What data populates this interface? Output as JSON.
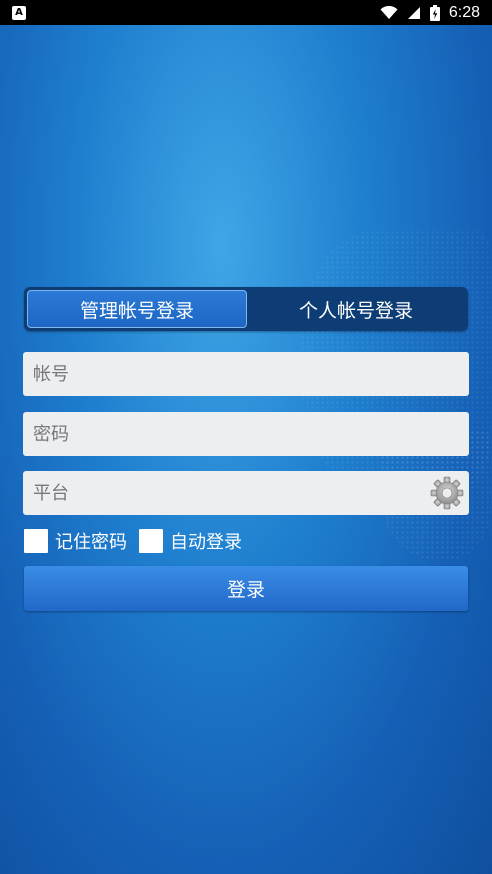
{
  "status_bar": {
    "time": "6:28",
    "app_icon": "a-app-icon",
    "icons": [
      "wifi-icon",
      "signal-icon",
      "battery-icon"
    ]
  },
  "tabs": [
    {
      "label": "管理帐号登录",
      "active": true
    },
    {
      "label": "个人帐号登录",
      "active": false
    }
  ],
  "form": {
    "account": {
      "placeholder": "帐号",
      "value": ""
    },
    "password": {
      "placeholder": "密码",
      "value": ""
    },
    "platform": {
      "placeholder": "平台",
      "value": ""
    },
    "remember_password": {
      "label": "记住密码",
      "checked": false
    },
    "auto_login": {
      "label": "自动登录",
      "checked": false
    },
    "login_button": "登录"
  },
  "colors": {
    "background": "#1f7fcf",
    "tab_bar": "#0e3d76",
    "tab_active": "#2470cc",
    "button": "#2b78d8",
    "field": "#eceef0"
  }
}
